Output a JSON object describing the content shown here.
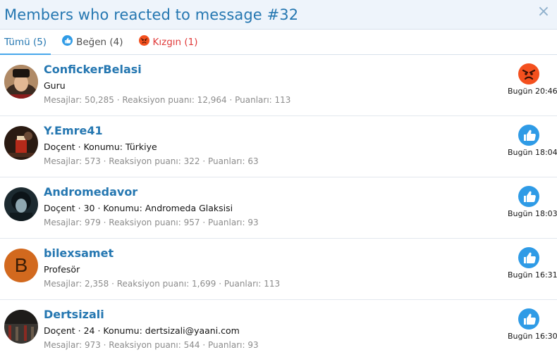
{
  "dialog": {
    "title": "Members who reacted to message #32",
    "close_label": "×"
  },
  "tabs": [
    {
      "label": "Tümü (5)"
    },
    {
      "label": "Beğen (4)"
    },
    {
      "label": "Kızgın (1)"
    }
  ],
  "members": [
    {
      "name": "ConfickerBelasi",
      "info": "Guru",
      "stats": "Mesajlar: 50,285 · Reaksiyon puanı: 12,964 · Puanları: 113",
      "reaction": "angry",
      "time": "Bugün 20:46"
    },
    {
      "name": "Y.Emre41",
      "info": "Doçent · Konumu: Türkiye",
      "stats": "Mesajlar: 573 · Reaksiyon puanı: 322 · Puanları: 63",
      "reaction": "like",
      "time": "Bugün 18:04"
    },
    {
      "name": "Andromedavor",
      "info": "Doçent · 30 · Konumu: Andromeda Glaksisi",
      "stats": "Mesajlar: 979 · Reaksiyon puanı: 957 · Puanları: 93",
      "reaction": "like",
      "time": "Bugün 18:03"
    },
    {
      "name": "bilexsamet",
      "avatar_letter": "B",
      "info": "Profesör",
      "stats": "Mesajlar: 2,358 · Reaksiyon puanı: 1,699 · Puanları: 113",
      "reaction": "like",
      "time": "Bugün 16:31"
    },
    {
      "name": "Dertsizali",
      "info": "Doçent · 24 · Konumu: dertsizali@yaani.com",
      "stats": "Mesajlar: 973 · Reaksiyon puanı: 544 · Puanları: 93",
      "reaction": "like",
      "time": "Bugün 16:30"
    }
  ],
  "colors": {
    "accent": "#2577b1",
    "like": "#2f9be6",
    "angry": "#f4501e"
  }
}
